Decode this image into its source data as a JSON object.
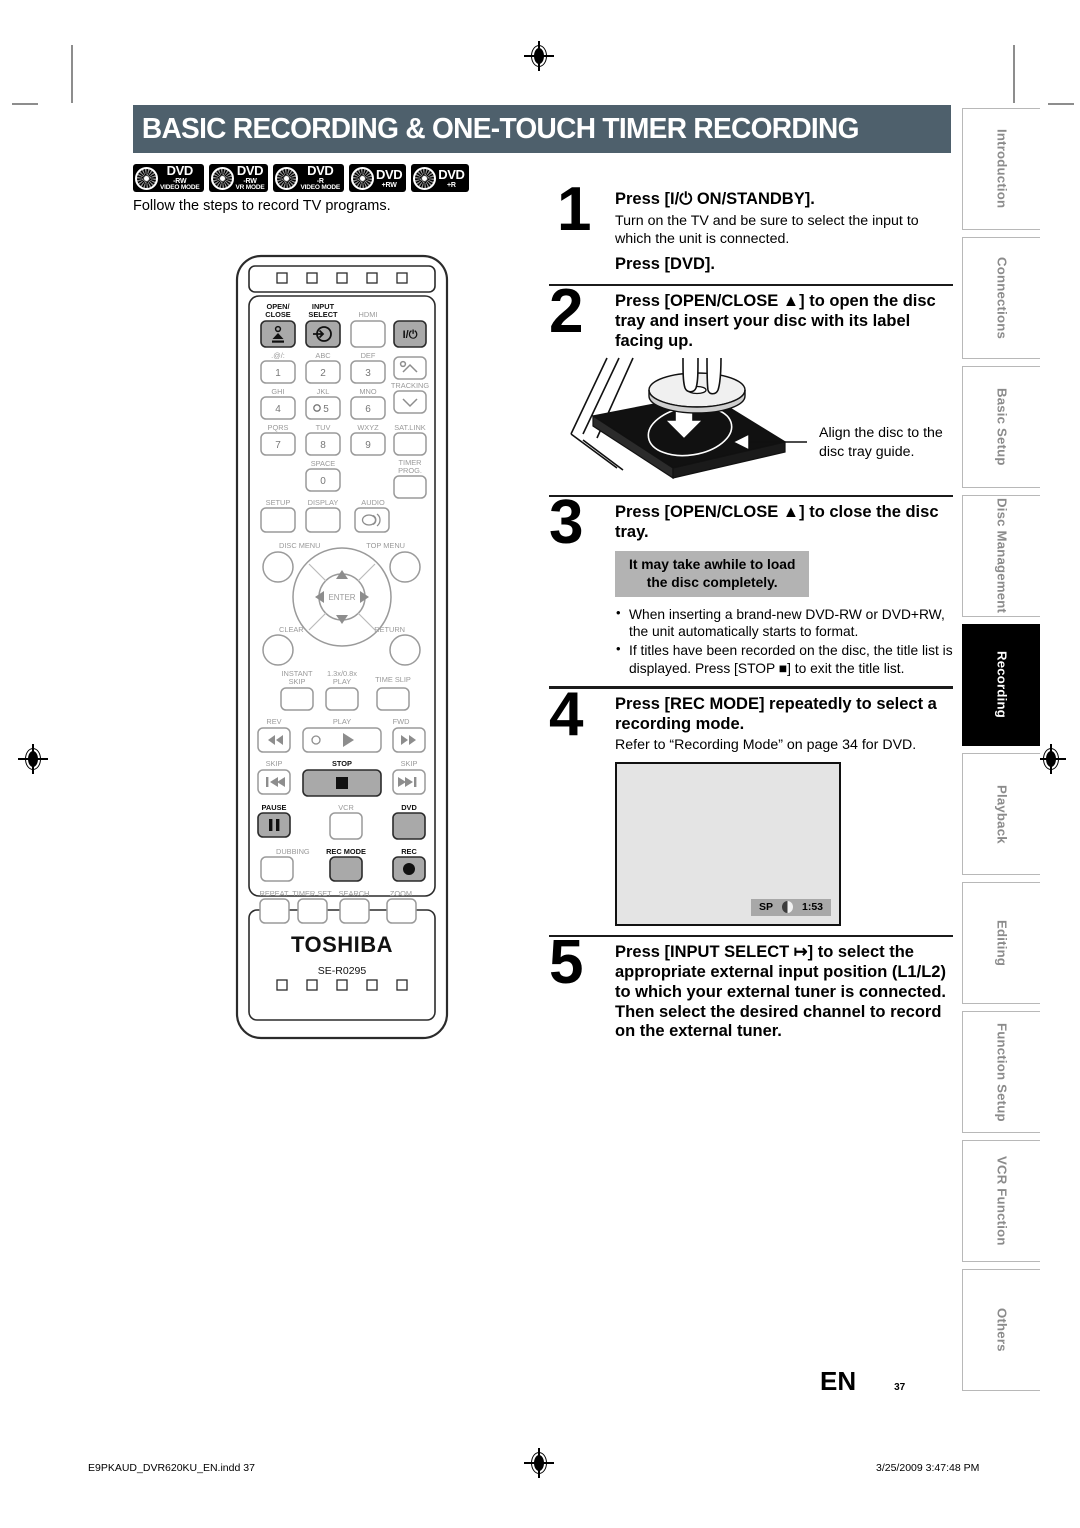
{
  "header": {
    "title": "BASIC RECORDING & ONE-TOUCH TIMER RECORDING",
    "bar_color": "#4e606c"
  },
  "disc_logos": [
    {
      "main": "DVD",
      "line2": "-RW",
      "line3": "VIDEO MODE"
    },
    {
      "main": "DVD",
      "line2": "-RW",
      "line3": "VR MODE"
    },
    {
      "main": "DVD",
      "line2": "-R",
      "line3": "VIDEO MODE"
    },
    {
      "main": "DVD",
      "line2": "+RW",
      "line3": ""
    },
    {
      "main": "DVD",
      "line2": "+R",
      "line3": ""
    }
  ],
  "intro": "Follow the steps to record TV programs.",
  "steps": [
    {
      "number": "1",
      "heading": "Press [I/⏻ ON/STANDBY].",
      "body": "Turn on the TV and be sure to select the input to which the unit is connected.",
      "heading2": "Press [DVD]."
    },
    {
      "number": "2",
      "heading": "Press [OPEN/CLOSE ▲] to open the disc tray and insert your disc with its label facing up.",
      "caption": "Align the disc to the disc tray guide."
    },
    {
      "number": "3",
      "heading": "Press [OPEN/CLOSE ▲] to close the disc tray.",
      "note_line1": "It may take awhile to load",
      "note_line2": "the disc completely.",
      "bullets": [
        "When inserting a brand-new DVD-RW or DVD+RW, the unit automatically starts to format.",
        "If titles have been recorded on the disc, the title list is displayed. Press [STOP ■] to exit the title list."
      ]
    },
    {
      "number": "4",
      "heading": "Press [REC MODE] repeatedly to select a recording mode.",
      "body": "Refer to “Recording Mode” on page 34 for DVD.",
      "osd": {
        "mode": "SP",
        "time": "1:53"
      }
    },
    {
      "number": "5",
      "heading": "Press [INPUT SELECT ↦] to select the appropriate external input position (L1/L2) to which your external tuner is connected. Then select the desired channel to record on the external tuner."
    }
  ],
  "rail_tabs": [
    {
      "label": "Introduction",
      "active": false
    },
    {
      "label": "Connections",
      "active": false
    },
    {
      "label": "Basic Setup",
      "active": false
    },
    {
      "label": "Disc Management",
      "active": false
    },
    {
      "label": "Recording",
      "active": true
    },
    {
      "label": "Playback",
      "active": false
    },
    {
      "label": "Editing",
      "active": false
    },
    {
      "label": "Function Setup",
      "active": false
    },
    {
      "label": "VCR Function",
      "active": false
    },
    {
      "label": "Others",
      "active": false
    }
  ],
  "page": {
    "lang": "EN",
    "number": "37"
  },
  "footer": {
    "left": "E9PKAUD_DVR620KU_EN.indd   37",
    "right": "3/25/2009   3:47:48 PM"
  },
  "remote": {
    "brand": "TOSHIBA",
    "model": "SE-R0295",
    "labels": {
      "open_close": "OPEN/\nCLOSE",
      "input_select": "INPUT\nSELECT",
      "hdmi": "HDMI",
      "power": "I/⏻",
      "k1_above": ".@/:",
      "k1": "1",
      "k2_above": "ABC",
      "k2": "2",
      "k3_above": "DEF",
      "k3": "3",
      "k4_above": "GHI",
      "k4": "4",
      "k5_above": "JKL",
      "k5": "5",
      "k6_above": "MNO",
      "k6": "6",
      "k7_above": "PQRS",
      "k7": "7",
      "k8_above": "TUV",
      "k8": "8",
      "k9_above": "WXYZ",
      "k9": "9",
      "k0_above": "SPACE",
      "k0": "0",
      "tracking": "TRACKING",
      "sat_link": "SAT.LINK",
      "timer_prog": "TIMER\nPROG.",
      "setup": "SETUP",
      "display": "DISPLAY",
      "audio": "AUDIO",
      "disc_menu": "DISC MENU",
      "top_menu": "TOP MENU",
      "enter": "ENTER",
      "clear": "CLEAR",
      "return": "RETURN",
      "instant_skip": "INSTANT\nSKIP",
      "speed_play": "1.3x/0.8x\nPLAY",
      "time_slip": "TIME SLIP",
      "rev": "REV",
      "play": "PLAY",
      "fwd": "FWD",
      "skip_back": "SKIP",
      "stop": "STOP",
      "skip_fwd": "SKIP",
      "pause": "PAUSE",
      "vcr": "VCR",
      "dvd": "DVD",
      "dubbing": "DUBBING",
      "rec_mode": "REC MODE",
      "rec": "REC",
      "repeat": "REPEAT",
      "timer_set": "TIMER SET",
      "search": "SEARCH",
      "zoom": "ZOOM"
    }
  }
}
